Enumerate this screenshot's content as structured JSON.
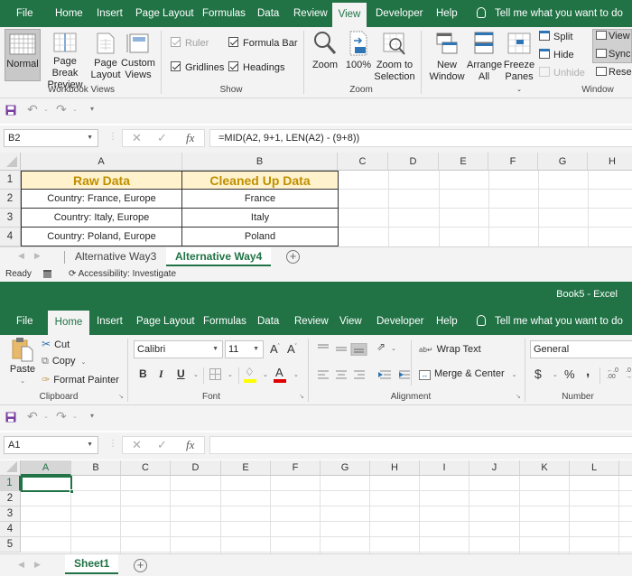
{
  "top_window": {
    "tabs": [
      "File",
      "Home",
      "Insert",
      "Page Layout",
      "Formulas",
      "Data",
      "Review",
      "View",
      "Developer",
      "Help"
    ],
    "active_tab": "View",
    "tell_me": "Tell me what you want to do",
    "ribbon": {
      "workbook_views": {
        "label": "Workbook Views",
        "buttons": [
          {
            "label_1": "Normal",
            "label_2": ""
          },
          {
            "label_1": "Page Break",
            "label_2": "Preview"
          },
          {
            "label_1": "Page",
            "label_2": "Layout"
          },
          {
            "label_1": "Custom",
            "label_2": "Views"
          }
        ]
      },
      "show": {
        "label": "Show",
        "ruler": "Ruler",
        "formula_bar": "Formula Bar",
        "gridlines": "Gridlines",
        "headings": "Headings"
      },
      "zoom": {
        "label": "Zoom",
        "zoom": "Zoom",
        "hundred": "100%",
        "zoom_to_1": "Zoom to",
        "zoom_to_2": "Selection"
      },
      "window": {
        "label": "Window",
        "new_1": "New",
        "new_2": "Window",
        "arrange_1": "Arrange",
        "arrange_2": "All",
        "freeze_1": "Freeze",
        "freeze_2": "Panes",
        "split": "Split",
        "hide": "Hide",
        "unhide": "Unhide",
        "view_side": "View",
        "sync": "Sync",
        "reset": "Rese"
      }
    },
    "name_box": "B2",
    "formula": "=MID(A2, 9+1, LEN(A2) - (9+8))",
    "columns": [
      "A",
      "B",
      "C",
      "D",
      "E",
      "F",
      "G",
      "H"
    ],
    "rows": [
      "1",
      "2",
      "3",
      "4"
    ],
    "table": {
      "headers": [
        "Raw Data",
        "Cleaned Up Data"
      ],
      "rows": [
        [
          "Country: France, Europe",
          "France"
        ],
        [
          "Country: Italy, Europe",
          "Italy"
        ],
        [
          "Country: Poland, Europe",
          "Poland"
        ]
      ],
      "header_fill": "#fff2cc",
      "header_text": "#bf9000"
    },
    "sheets": [
      "Alternative Way3",
      "Alternative Way4"
    ],
    "active_sheet": "Alternative Way4",
    "status_ready": "Ready",
    "status_accessibility": "Accessibility: Investigate"
  },
  "bottom_window": {
    "title": "Book5  -  Excel",
    "tabs": [
      "File",
      "Home",
      "Insert",
      "Page Layout",
      "Formulas",
      "Data",
      "Review",
      "View",
      "Developer",
      "Help"
    ],
    "active_tab": "Home",
    "tell_me": "Tell me what you want to do",
    "ribbon": {
      "clipboard": {
        "label": "Clipboard",
        "paste": "Paste",
        "cut": "Cut",
        "copy": "Copy",
        "format_painter": "Format Painter"
      },
      "font": {
        "label": "Font",
        "font_name": "Calibri",
        "font_size": "11",
        "bold": "B",
        "italic": "I",
        "underline": "U"
      },
      "alignment": {
        "label": "Alignment",
        "wrap_text": "Wrap Text",
        "merge_center": "Merge & Center"
      },
      "number": {
        "label": "Number",
        "format": "General",
        "currency": "$",
        "percent": "%",
        "comma": ","
      }
    },
    "name_box": "A1",
    "formula": "",
    "columns": [
      "A",
      "B",
      "C",
      "D",
      "E",
      "F",
      "G",
      "H",
      "I",
      "J",
      "K",
      "L"
    ],
    "rows": [
      "1",
      "2",
      "3",
      "4",
      "5"
    ],
    "sheets": [
      "Sheet1"
    ],
    "active_sheet": "Sheet1"
  },
  "colors": {
    "excel_green": "#217346",
    "ribbon_bg": "#f3f3f3"
  }
}
